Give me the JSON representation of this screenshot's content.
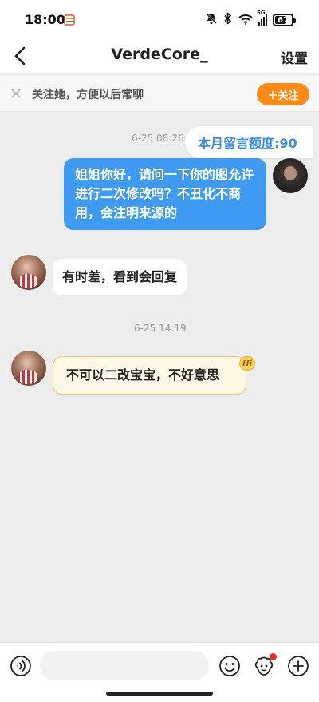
{
  "status_bar": {
    "time": "18:00",
    "battery": "67",
    "battery_level": 0.67,
    "network": "5G",
    "icons": [
      "mute-icon",
      "bluetooth-icon",
      "wifi-icon",
      "cellular-icon",
      "battery-icon"
    ]
  },
  "header": {
    "back_icon": "chevron-left-icon",
    "title": "VerdeCore_",
    "settings_label": "设置"
  },
  "follow_bar": {
    "text": "关注她，方便以后常聊",
    "button_label": "＋关注",
    "accent": "#ff8a16"
  },
  "chat": {
    "quota": "本月留言额度:90",
    "messages": [
      {
        "side": "right",
        "timestamp": "6-25 08:26",
        "text": "姐姐你好，请问一下你的图允许进行二次修改吗？不丑化不商用，会注明来源的"
      },
      {
        "side": "left",
        "text": "有时差，看到会回复"
      },
      {
        "side": "left",
        "timestamp": "6-25 14:19",
        "text": "不可以二改宝宝，不好意思",
        "badge": "Hi"
      }
    ],
    "colors": {
      "outgoing": "#3f9bf2",
      "quota_text": "#3a8be6"
    }
  },
  "composer": {
    "voice_icon": "voice-icon",
    "emoji_icon": "emoji-icon",
    "sticker_icon": "sticker-icon",
    "plus_icon": "plus-icon",
    "placeholder": ""
  }
}
